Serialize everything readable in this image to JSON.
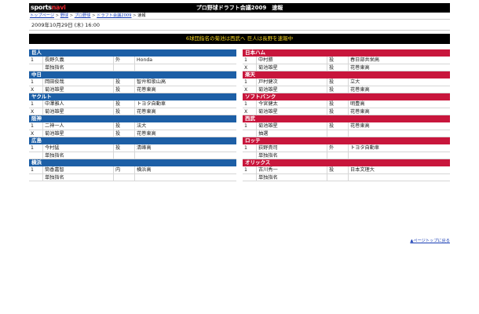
{
  "header": {
    "logo_main": "sports",
    "logo_accent": "navi",
    "title": "プロ野球ドラフト会議2009　速報"
  },
  "breadcrumb": [
    {
      "label": "トップページ"
    },
    {
      "label": "野球"
    },
    {
      "label": "プロ野球"
    },
    {
      "label": "ドラフト会議2009"
    },
    {
      "label": "速報"
    }
  ],
  "date": "2009年10月29日 (木) 16:00",
  "banner": "6球団指名の菊池は西武へ 巨人は長野を速報中",
  "left_teams": [
    {
      "name": "巨人",
      "rows": [
        {
          "no": "1",
          "player": "長野久義",
          "pos": "外",
          "school": "Honda"
        },
        {
          "no": "",
          "player": "単独指名",
          "pos": "",
          "school": ""
        }
      ]
    },
    {
      "name": "中日",
      "rows": [
        {
          "no": "1",
          "player": "岡田俊哉",
          "pos": "投",
          "school": "智弁和歌山高"
        },
        {
          "no": "X",
          "player": "菊池雄星",
          "pos": "投",
          "school": "花巻東高"
        }
      ]
    },
    {
      "name": "ヤクルト",
      "rows": [
        {
          "no": "1",
          "player": "中澤雅人",
          "pos": "投",
          "school": "トヨタ自動車"
        },
        {
          "no": "X",
          "player": "菊池雄星",
          "pos": "投",
          "school": "花巻東高"
        }
      ]
    },
    {
      "name": "阪神",
      "rows": [
        {
          "no": "1",
          "player": "二神一人",
          "pos": "投",
          "school": "法大"
        },
        {
          "no": "X",
          "player": "菊池雄星",
          "pos": "投",
          "school": "花巻東高"
        }
      ]
    },
    {
      "name": "広島",
      "rows": [
        {
          "no": "1",
          "player": "今村猛",
          "pos": "投",
          "school": "清峰高"
        },
        {
          "no": "",
          "player": "単独指名",
          "pos": "",
          "school": ""
        }
      ]
    },
    {
      "name": "横浜",
      "rows": [
        {
          "no": "1",
          "player": "筒香嘉智",
          "pos": "内",
          "school": "横浜高"
        },
        {
          "no": "",
          "player": "単独指名",
          "pos": "",
          "school": ""
        }
      ]
    }
  ],
  "right_teams": [
    {
      "name": "日本ハム",
      "rows": [
        {
          "no": "1",
          "player": "中村勝",
          "pos": "投",
          "school": "春日部共栄高"
        },
        {
          "no": "X",
          "player": "菊池雄星",
          "pos": "投",
          "school": "花巻東高"
        }
      ]
    },
    {
      "name": "楽天",
      "rows": [
        {
          "no": "1",
          "player": "戸村健次",
          "pos": "投",
          "school": "立大"
        },
        {
          "no": "X",
          "player": "菊池雄星",
          "pos": "投",
          "school": "花巻東高"
        }
      ]
    },
    {
      "name": "ソフトバンク",
      "rows": [
        {
          "no": "1",
          "player": "今宮健太",
          "pos": "投",
          "school": "明豊高"
        },
        {
          "no": "X",
          "player": "菊池雄星",
          "pos": "投",
          "school": "花巻東高"
        }
      ]
    },
    {
      "name": "西武",
      "rows": [
        {
          "no": "1",
          "player": "菊池雄星",
          "pos": "投",
          "school": "花巻東高"
        },
        {
          "no": "",
          "player": "抽選",
          "pos": "",
          "school": ""
        }
      ]
    },
    {
      "name": "ロッテ",
      "rows": [
        {
          "no": "1",
          "player": "荻野貴司",
          "pos": "外",
          "school": "トヨタ自動車"
        },
        {
          "no": "",
          "player": "単独指名",
          "pos": "",
          "school": ""
        }
      ]
    },
    {
      "name": "オリックス",
      "rows": [
        {
          "no": "1",
          "player": "古川秀一",
          "pos": "投",
          "school": "日本文理大"
        },
        {
          "no": "",
          "player": "単独指名",
          "pos": "",
          "school": ""
        }
      ]
    }
  ],
  "footer": {
    "page_top_link": "▲ページトップに戻る"
  },
  "colors": {
    "central_league": "#1d5fa6",
    "pacific_league": "#c8163c",
    "banner_text": "#f0d020"
  }
}
